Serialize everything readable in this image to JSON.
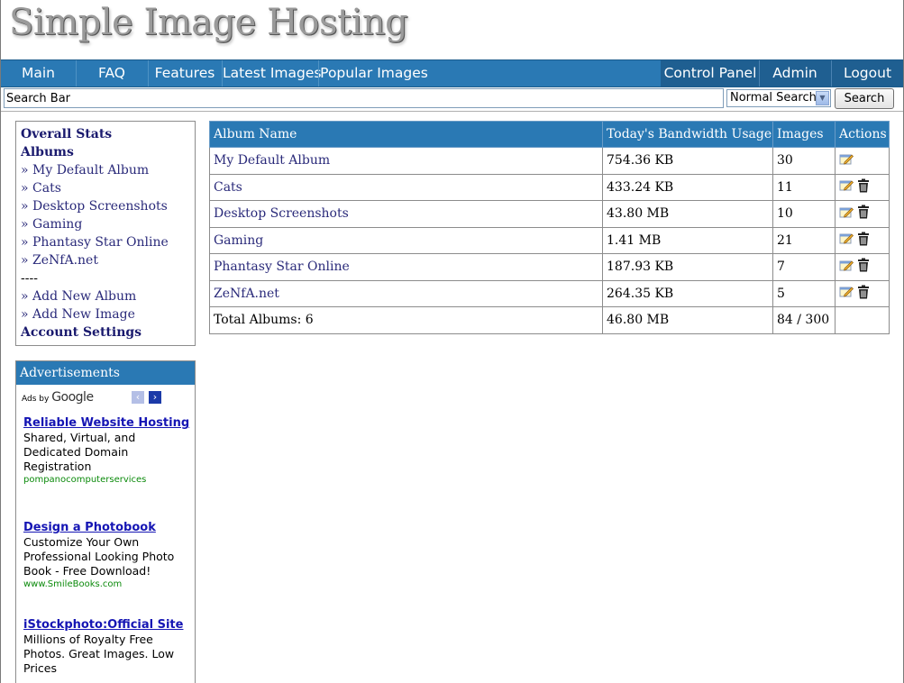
{
  "logo": {
    "text": "Simple Image Hosting"
  },
  "nav": {
    "main": "Main",
    "faq": "FAQ",
    "features": "Features",
    "latest": "Latest Images",
    "popular": "Popular Images",
    "control_panel": "Control Panel",
    "admin": "Admin",
    "logout": "Logout"
  },
  "search": {
    "value": "Search Bar",
    "mode": "Normal Search",
    "button": "Search"
  },
  "sidebar": {
    "overall_stats": "Overall Stats",
    "albums_heading": "Albums",
    "albums": [
      "» My Default Album",
      "» Cats",
      "» Desktop Screenshots",
      "» Gaming",
      "» Phantasy Star Online",
      "» ZeNfA.net"
    ],
    "separator": "----",
    "add_album": "» Add New Album",
    "add_image": "» Add New Image",
    "account_settings": "Account Settings"
  },
  "ads": {
    "header": "Advertisements",
    "ads_by": "Ads by",
    "google": "Google",
    "items": [
      {
        "title": "Reliable Website Hosting",
        "desc": "Shared, Virtual, and Dedicated Domain Registration",
        "url": "pompanocomputerservices"
      },
      {
        "title": "Design a Photobook",
        "desc": "Customize Your Own Professional Looking Photo Book - Free Download!",
        "url": "www.SmileBooks.com"
      },
      {
        "title": "iStockphoto:Official Site",
        "desc": "Millions of Royalty Free Photos. Great Images. Low Prices",
        "url": ""
      }
    ]
  },
  "table": {
    "headers": [
      "Album Name",
      "Today's Bandwidth Usage",
      "Images",
      "Actions"
    ],
    "rows": [
      {
        "name": "My Default Album",
        "bandwidth": "754.36 KB",
        "images": "30",
        "deletable": false
      },
      {
        "name": "Cats",
        "bandwidth": "433.24 KB",
        "images": "11",
        "deletable": true
      },
      {
        "name": "Desktop Screenshots",
        "bandwidth": "43.80 MB",
        "images": "10",
        "deletable": true
      },
      {
        "name": "Gaming",
        "bandwidth": "1.41 MB",
        "images": "21",
        "deletable": true
      },
      {
        "name": "Phantasy Star Online",
        "bandwidth": "187.93 KB",
        "images": "7",
        "deletable": true
      },
      {
        "name": "ZeNfA.net",
        "bandwidth": "264.35 KB",
        "images": "5",
        "deletable": true
      }
    ],
    "total": {
      "label": "Total Albums: 6",
      "bandwidth": "46.80 MB",
      "images": "84 / 300"
    }
  },
  "colors": {
    "nav_bg": "#2a79b4",
    "nav_active_bg": "#1f5f91",
    "link": "#2a2a7a",
    "ad_url": "#0b8a0b"
  },
  "icons": {
    "edit": "edit-pencil-icon",
    "delete": "trash-icon"
  }
}
